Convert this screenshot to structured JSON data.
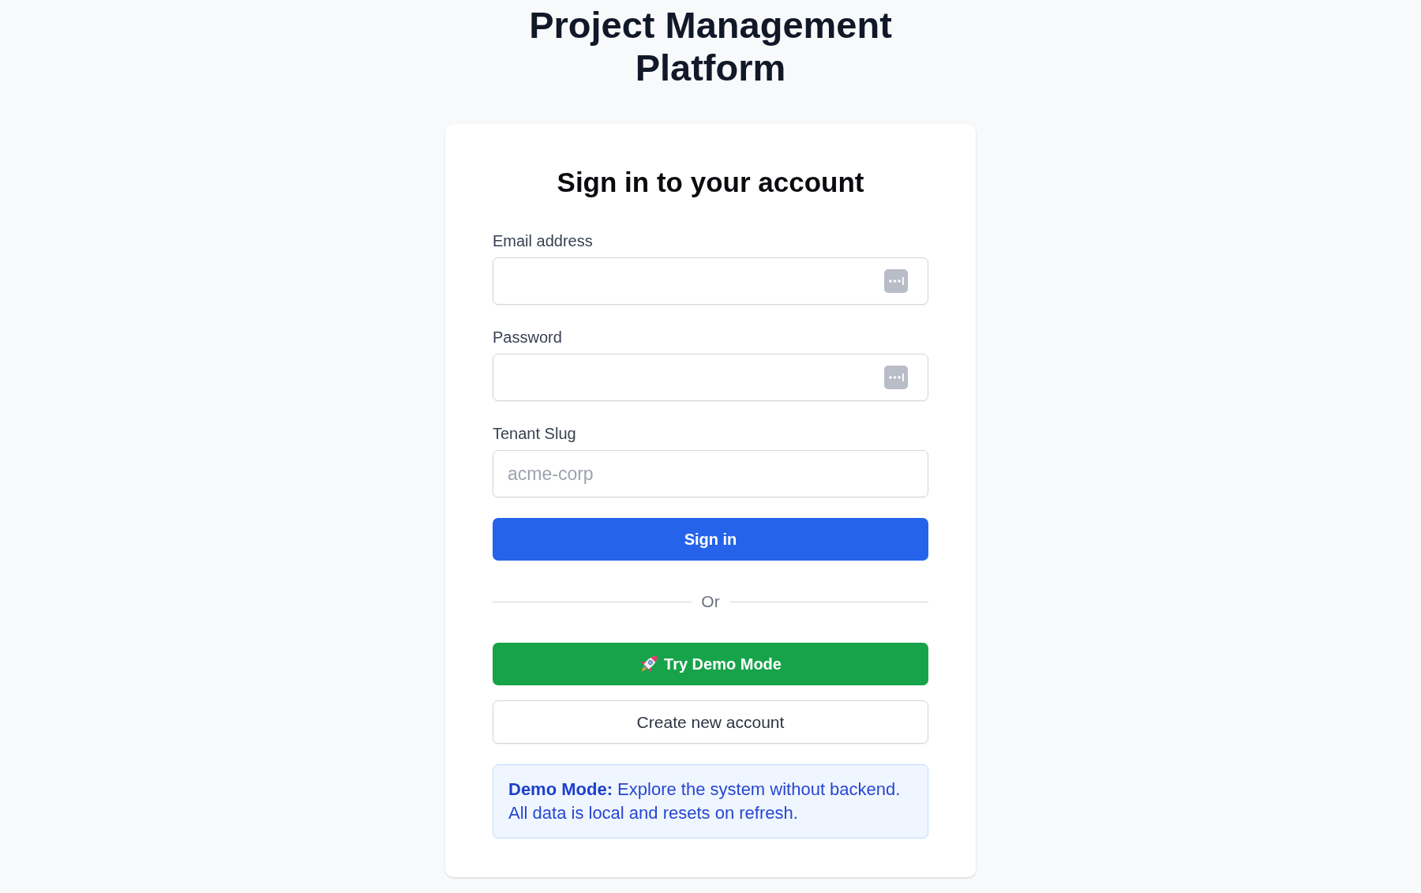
{
  "page_title": "Project Management Platform",
  "card": {
    "heading": "Sign in to your account",
    "fields": [
      {
        "label": "Email address",
        "autofill_icon": true
      },
      {
        "label": "Password",
        "autofill_icon": true
      },
      {
        "label": "Tenant Slug",
        "placeholder": "acme-corp"
      }
    ],
    "sign_in_button": {
      "label": "Sign in"
    },
    "divider_text": "Or",
    "alt_buttons": [
      {
        "kind": "demo",
        "label": "Try Demo Mode"
      },
      {
        "kind": "secondary",
        "label": "Create new account"
      }
    ],
    "notice": "**Demo Mode:** Explore the system without backend. All data is local and resets on refresh."
  }
}
